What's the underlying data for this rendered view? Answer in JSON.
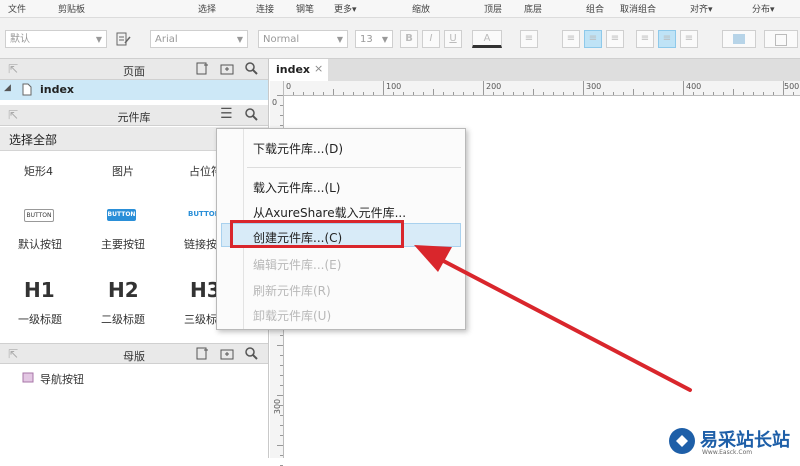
{
  "menubar": {
    "items": [
      "文件",
      "剪贴板",
      "选择",
      "连接",
      "钢笔",
      "更多▾",
      "缩放",
      "顶层",
      "底层",
      "组合",
      "取消组合",
      "对齐▾",
      "分布▾"
    ]
  },
  "format_toolbar": {
    "style_select": "默认",
    "font_select": "Arial",
    "weight_select": "Normal",
    "size_select": "13",
    "bold": "B",
    "italic": "I",
    "underline": "U",
    "font_color": "A"
  },
  "pages_panel": {
    "title": "页面",
    "page_name": "index"
  },
  "library_panel": {
    "title": "元件库",
    "select_value": "选择全部",
    "widgets_row1": [
      "矩形4",
      "图片",
      "占位符"
    ],
    "button_captions": [
      "BUTTON",
      "BUTTON",
      "BUTTON"
    ],
    "widgets_row2": [
      "默认按钮",
      "主要按钮",
      "链接按钮"
    ],
    "headings_big": [
      "H1",
      "H2",
      "H3"
    ],
    "widgets_row3": [
      "一级标题",
      "二级标题",
      "三级标题"
    ]
  },
  "masters_panel": {
    "title": "母版",
    "item_name": "导航按钮"
  },
  "canvas": {
    "tab_label": "index",
    "tab_close": "×",
    "ruler_top_labels": [
      "0",
      "100",
      "200",
      "300",
      "400",
      "500"
    ],
    "ruler_left_labels": [
      "0",
      "300"
    ]
  },
  "context_menu": {
    "items": [
      {
        "label": "下载元件库...(D)",
        "enabled": true
      },
      {
        "label": "载入元件库...(L)",
        "enabled": true
      },
      {
        "label": "从AxureShare载入元件库...",
        "enabled": true
      },
      {
        "label": "创建元件库...(C)",
        "enabled": true,
        "highlighted": true
      },
      {
        "label": "编辑元件库...(E)",
        "enabled": false
      },
      {
        "label": "刷新元件库(R)",
        "enabled": false
      },
      {
        "label": "卸载元件库(U)",
        "enabled": false
      }
    ]
  },
  "watermark": {
    "text": "易采站长站",
    "subtext": "Www.Easck.Com"
  },
  "colors": {
    "annotation_red": "#d9262c",
    "selection_blue": "#cde8f7",
    "button_blue": "#2a8fd8"
  },
  "icons": [
    "page-icon",
    "add-page-icon",
    "add-folder-icon",
    "search-icon",
    "menu-icon",
    "master-icon",
    "close-icon",
    "arrow-icon"
  ]
}
